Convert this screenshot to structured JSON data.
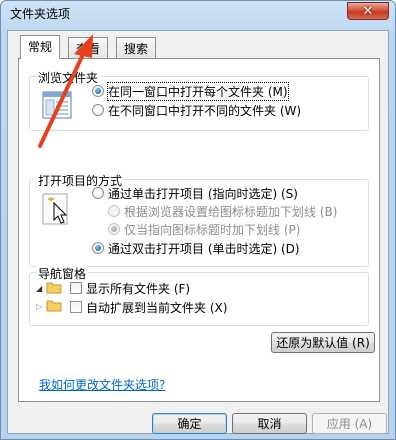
{
  "window": {
    "title": "文件夹选项",
    "close_glyph": "✕"
  },
  "tabs": [
    {
      "label": "常规",
      "active": true
    },
    {
      "label": "查看",
      "active": false
    },
    {
      "label": "搜索",
      "active": false
    }
  ],
  "browse_group": {
    "label": "浏览文件夹",
    "options": [
      {
        "label": "在同一窗口中打开每个文件夹 (M)",
        "checked": true
      },
      {
        "label": "在不同窗口中打开不同的文件夹 (W)",
        "checked": false
      }
    ]
  },
  "click_group": {
    "label": "打开项目的方式",
    "options": [
      {
        "label": "通过单击打开项目 (指向时选定) (S)",
        "checked": false,
        "disabled": false
      },
      {
        "label": "根据浏览器设置给图标标题加下划线 (B)",
        "checked": false,
        "disabled": true
      },
      {
        "label": "仅当指向图标标题时加下划线 (P)",
        "checked": true,
        "disabled": true
      },
      {
        "label": "通过双击打开项目 (单击时选定) (D)",
        "checked": true,
        "disabled": false
      }
    ]
  },
  "nav_group": {
    "label": "导航窗格",
    "options": [
      {
        "label": "显示所有文件夹 (F)",
        "checked": false
      },
      {
        "label": "自动扩展到当前文件夹 (X)",
        "checked": false
      }
    ]
  },
  "restore_button": "还原为默认值 (R)",
  "help_link": "我如何更改文件夹选项?",
  "buttons": {
    "ok": "确定",
    "cancel": "取消",
    "apply": "应用 (A)"
  },
  "annotation": {
    "arrow_color": "#e8401c"
  }
}
